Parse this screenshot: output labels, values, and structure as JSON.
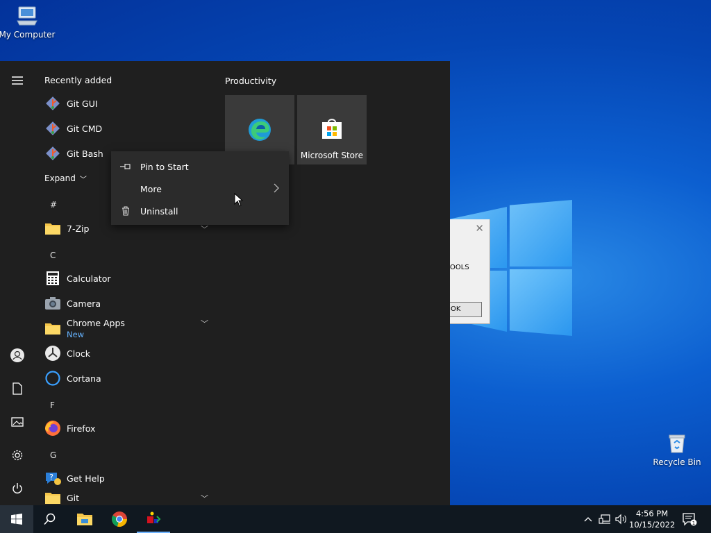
{
  "desktop": {
    "my_computer": "My Computer",
    "recycle_bin": "Recycle Bin"
  },
  "dialog": {
    "text": "OOLS",
    "button": "OK"
  },
  "start_menu": {
    "recently_added": "Recently added",
    "recent_items": [
      "Git GUI",
      "Git CMD",
      "Git Bash"
    ],
    "expand": "Expand",
    "sections": {
      "hash": "#",
      "c": "C",
      "f": "F",
      "g": "G"
    },
    "apps": {
      "seven_zip": "7-Zip",
      "calculator": "Calculator",
      "camera": "Camera",
      "chrome_apps": "Chrome Apps",
      "chrome_apps_badge": "New",
      "clock": "Clock",
      "cortana": "Cortana",
      "firefox": "Firefox",
      "get_help": "Get Help",
      "git": "Git"
    },
    "productivity_title": "Productivity",
    "tiles": {
      "store": "Microsoft Store"
    }
  },
  "context_menu": {
    "pin": "Pin to Start",
    "more": "More",
    "uninstall": "Uninstall"
  },
  "taskbar": {
    "time": "4:56 PM",
    "date": "10/15/2022",
    "notification_count": "1"
  },
  "colors": {
    "accent_blue": "#0a5fd0",
    "menu_bg": "#1f1f1f",
    "tile_bg": "#3a3a3a",
    "new_badge": "#66b3ff"
  }
}
